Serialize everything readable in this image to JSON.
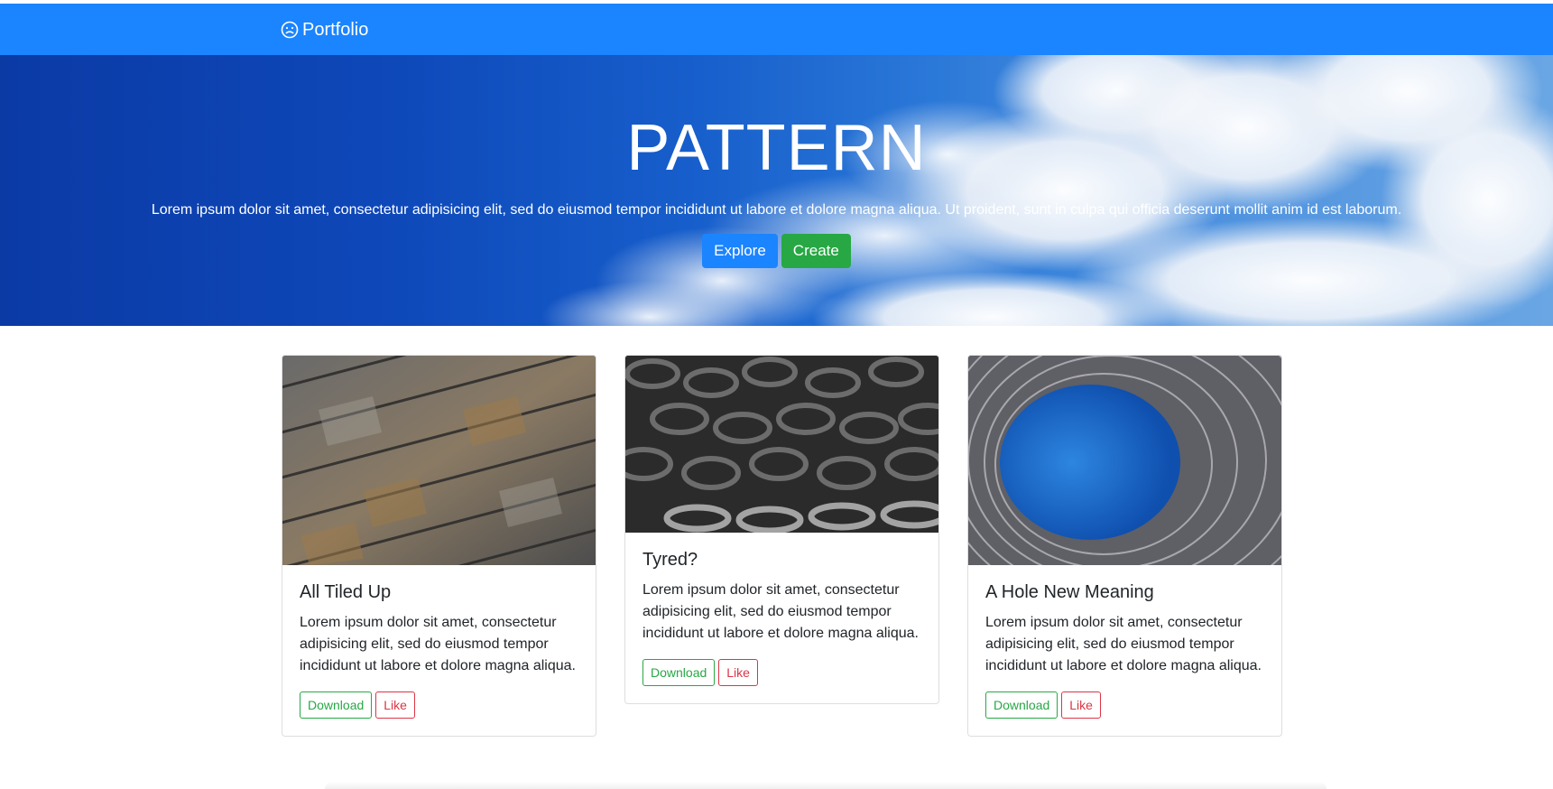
{
  "navbar": {
    "brand_icon": "smiley-icon",
    "brand_label": "Portfolio",
    "color": "#1b84ff"
  },
  "hero": {
    "title": "PATTERN",
    "text": "Lorem ipsum dolor sit amet, consectetur adipisicing elit, sed do eiusmod tempor incididunt ut labore et dolore magna aliqua. Ut proident, sunt in culpa qui officia deserunt mollit anim id est laborum.",
    "buttons": {
      "explore": "Explore",
      "create": "Create"
    },
    "background": "blue sky with clouds"
  },
  "cards": [
    {
      "image": "slate roof tiles",
      "title": "All Tiled Up",
      "text": "Lorem ipsum dolor sit amet, consectetur adipisicing elit, sed do eiusmod tempor incididunt ut labore et dolore magna aliqua.",
      "download_label": "Download",
      "like_label": "Like"
    },
    {
      "image": "stacked black tyres",
      "title": "Tyred?",
      "text": "Lorem ipsum dolor sit amet, consectetur adipisicing elit, sed do eiusmod tempor incididunt ut labore et dolore magna aliqua.",
      "download_label": "Download",
      "like_label": "Like"
    },
    {
      "image": "lattice building opening to sky",
      "title": "A Hole New Meaning",
      "text": "Lorem ipsum dolor sit amet, consectetur adipisicing elit, sed do eiusmod tempor incididunt ut labore et dolore magna aliqua.",
      "download_label": "Download",
      "like_label": "Like"
    }
  ],
  "colors": {
    "primary": "#1b84ff",
    "success": "#27a844",
    "danger": "#dc3545"
  }
}
